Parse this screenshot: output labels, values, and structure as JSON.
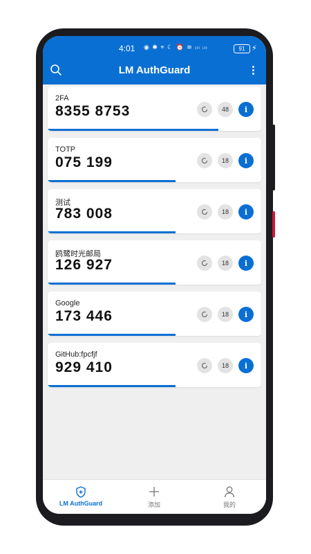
{
  "status": {
    "time": "4:01",
    "icons": "◉ ✱ ⌖ ☾ ⏰ ≋ ᵢₗₗ ᵢₗₗ",
    "battery": "91",
    "charge": "⚡"
  },
  "appbar": {
    "title": "LM AuthGuard",
    "search_icon": "search-icon",
    "menu_icon": "more-vertical-icon"
  },
  "accounts": [
    {
      "name": "2FA",
      "code": "8355 8753",
      "timer": "48",
      "progress": 0.8
    },
    {
      "name": "TOTP",
      "code": "075 199",
      "timer": "18",
      "progress": 0.6
    },
    {
      "name": "测试",
      "code": "783 008",
      "timer": "18",
      "progress": 0.6
    },
    {
      "name": "鸥鹭时光邮局",
      "code": "126 927",
      "timer": "18",
      "progress": 0.6
    },
    {
      "name": "Google",
      "code": "173 446",
      "timer": "18",
      "progress": 0.6
    },
    {
      "name": "GitHub:fpcfjf",
      "code": "929 410",
      "timer": "18",
      "progress": 0.6
    }
  ],
  "info_label": "i",
  "bottom_nav": [
    {
      "label": "LM AuthGuard",
      "icon": "shield-plus-icon",
      "active": true
    },
    {
      "label": "添加",
      "icon": "plus-icon",
      "active": false
    },
    {
      "label": "我的",
      "icon": "person-icon",
      "active": false
    }
  ],
  "colors": {
    "accent": "#0a6fd3",
    "background": "#efefef"
  }
}
